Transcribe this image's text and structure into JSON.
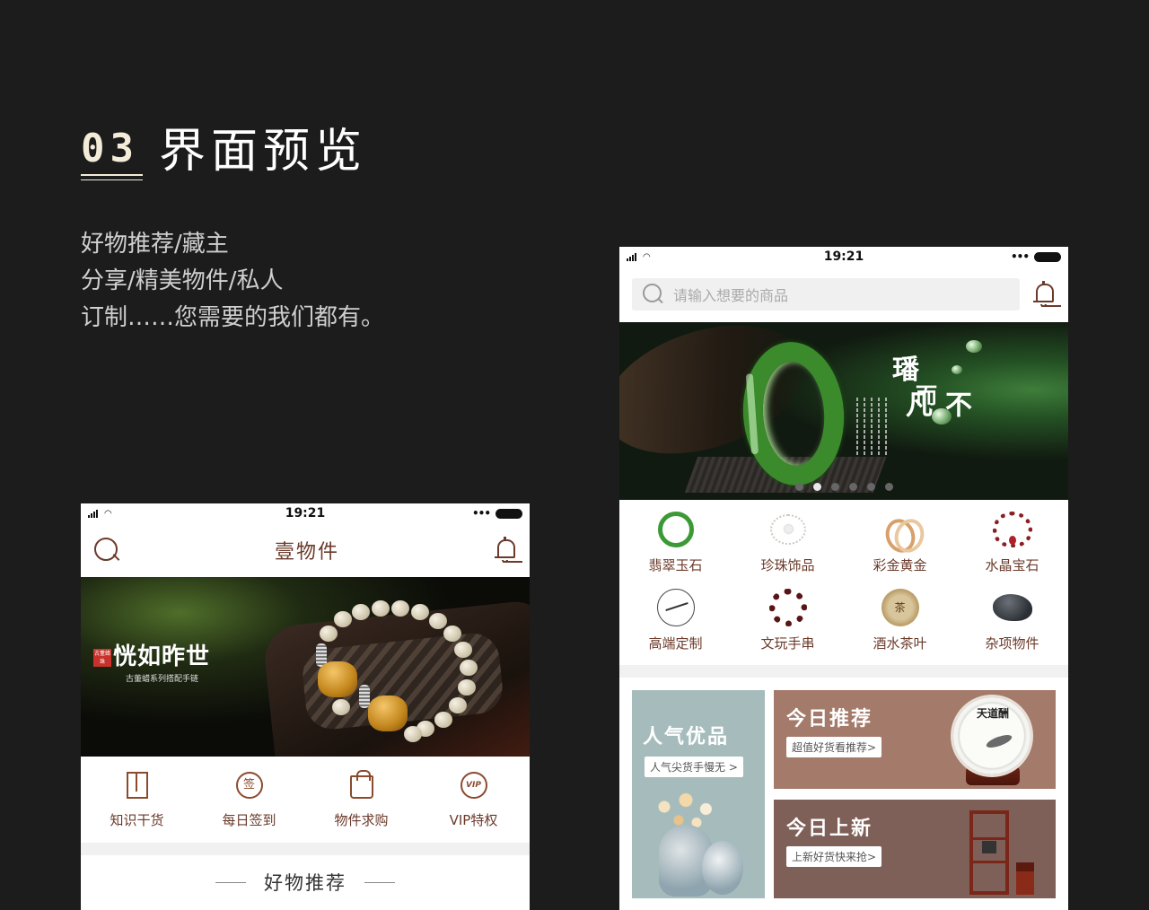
{
  "page": {
    "heading": {
      "number": "03",
      "title": "界面预览"
    },
    "intro": [
      "好物推荐/藏主",
      "分享/精美物件/私人",
      "订制……您需要的我们都有。"
    ]
  },
  "phone_a": {
    "status": {
      "time": "19:21"
    },
    "header": {
      "title": "壹物件",
      "search_icon": "search-icon",
      "bell_icon": "bell-icon"
    },
    "banner": {
      "seal_text": "古董蜡珠",
      "slogan": "恍如昨世",
      "subtitle": "古董蜡系列搭配手链"
    },
    "quick_actions": [
      {
        "label": "知识干货",
        "icon": "book-icon"
      },
      {
        "label": "每日签到",
        "icon": "sign-in-icon",
        "glyph": "签"
      },
      {
        "label": "物件求购",
        "icon": "shopping-bag-icon"
      },
      {
        "label": "VIP特权",
        "icon": "vip-icon",
        "glyph": "VIP"
      }
    ],
    "section_title": "好物推荐"
  },
  "phone_b": {
    "status": {
      "time": "19:21"
    },
    "search": {
      "placeholder": "请输入想要的商品"
    },
    "banner": {
      "callig_1": "璠",
      "callig_2": "而",
      "callig_3": "不凡",
      "dots_total": 6,
      "active_dot": 1
    },
    "categories": [
      {
        "label": "翡翠玉石",
        "icon": "jade-bangle-icon"
      },
      {
        "label": "珍珠饰品",
        "icon": "pearl-necklace-icon"
      },
      {
        "label": "彩金黄金",
        "icon": "gold-rings-icon"
      },
      {
        "label": "水晶宝石",
        "icon": "crystal-bracelet-icon"
      },
      {
        "label": "高端定制",
        "icon": "custom-ornament-icon"
      },
      {
        "label": "文玩手串",
        "icon": "prayer-beads-icon"
      },
      {
        "label": "酒水茶叶",
        "icon": "tea-cake-icon",
        "glyph": "茶"
      },
      {
        "label": "杂项物件",
        "icon": "stone-icon"
      }
    ],
    "promos": {
      "popular": {
        "title": "人气优品",
        "tag": "人气尖货手慢无 >"
      },
      "today_pick": {
        "title": "今日推荐",
        "tag": "超值好货看推荐>",
        "plate_text": "天道酬"
      },
      "today_new": {
        "title": "今日上新",
        "tag": "上新好货快来抢>"
      }
    }
  },
  "colors": {
    "background": "#1c1c1c",
    "accent_brown": "#6b3a2a",
    "popular_card": "#a6bcbc",
    "pick_card": "#a47a6a",
    "new_card": "#7e6058",
    "jade_green": "#3b8a2c"
  }
}
